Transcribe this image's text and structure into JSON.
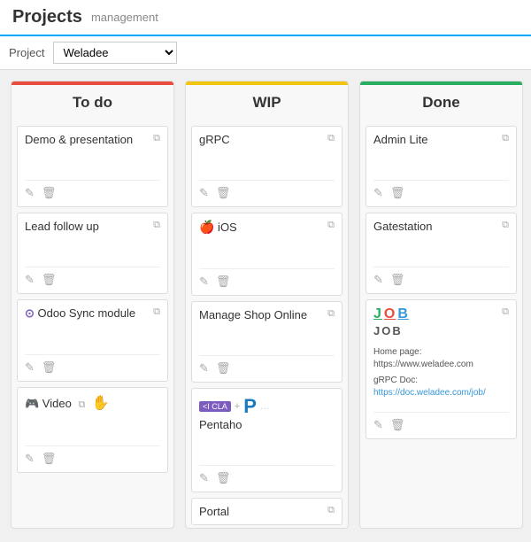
{
  "header": {
    "title": "Projects",
    "subtitle": "management"
  },
  "toolbar": {
    "project_label": "Project",
    "project_value": "Weladee"
  },
  "columns": [
    {
      "id": "todo",
      "label": "To do",
      "cards": [
        {
          "id": "demo",
          "title": "Demo & presentation",
          "has_icon": true,
          "content": ""
        },
        {
          "id": "lead",
          "title": "Lead follow up",
          "has_icon": true,
          "content": ""
        },
        {
          "id": "odoo",
          "title": "Odoo Sync module",
          "has_icon": true,
          "content": "",
          "special": "odoo"
        },
        {
          "id": "video",
          "title": "Video",
          "has_icon": true,
          "content": "",
          "special": "video"
        }
      ]
    },
    {
      "id": "wip",
      "label": "WIP",
      "cards": [
        {
          "id": "grpc",
          "title": "gRPC",
          "has_icon": true,
          "content": ""
        },
        {
          "id": "ios",
          "title": "iOS",
          "has_icon": true,
          "content": "",
          "special": "apple"
        },
        {
          "id": "manage-shop",
          "title": "Manage Shop Online",
          "has_icon": true,
          "content": ""
        },
        {
          "id": "pentaho",
          "title": "Pentaho",
          "has_icon": false,
          "content": "",
          "special": "pentaho"
        },
        {
          "id": "portal",
          "title": "Portal",
          "has_icon": true,
          "content": ""
        }
      ]
    },
    {
      "id": "done",
      "label": "Done",
      "cards": [
        {
          "id": "adminlite",
          "title": "Admin Lite",
          "has_icon": true,
          "content": ""
        },
        {
          "id": "gatestation",
          "title": "Gatestation",
          "has_icon": true,
          "content": ""
        },
        {
          "id": "job",
          "title": "JOB",
          "has_icon": true,
          "content": "",
          "special": "job"
        }
      ]
    }
  ],
  "icons": {
    "edit": "✎",
    "delete": "🗑",
    "card_icon": "⧉",
    "odoo": "⊙",
    "video": "🎮",
    "hand": "✋",
    "apple": "🍎"
  }
}
